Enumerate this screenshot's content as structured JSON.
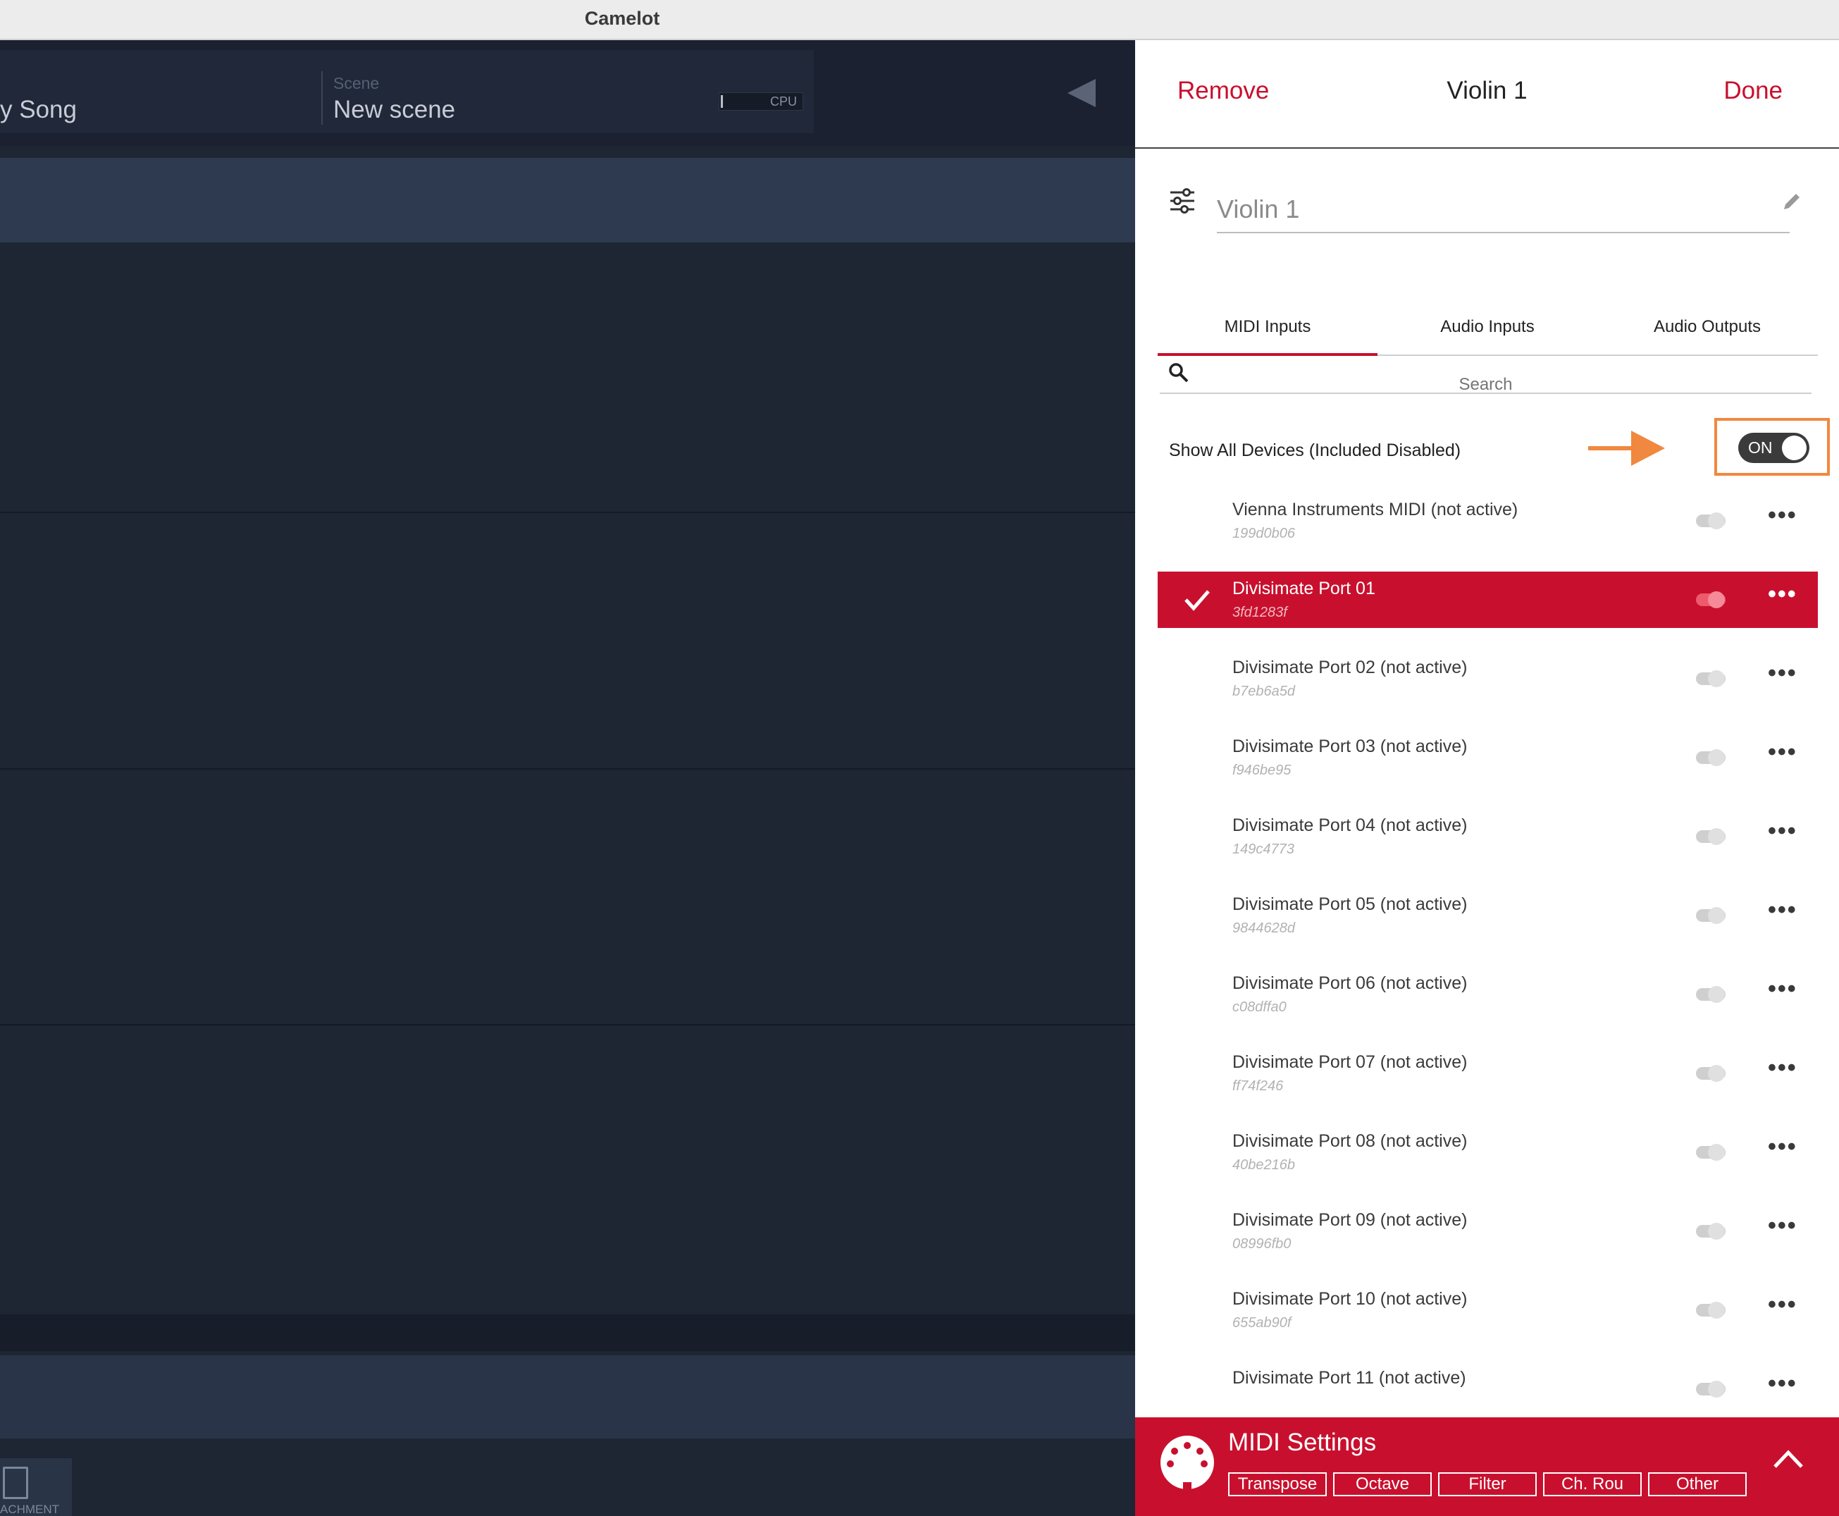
{
  "window": {
    "title": "Camelot"
  },
  "app": {
    "song_label": "y Song",
    "scene_caption": "Scene",
    "scene_name": "New scene",
    "cpu_label": "CPU",
    "attachment_label": "ACHMENT"
  },
  "panel": {
    "remove_label": "Remove",
    "title": "Violin 1",
    "done_label": "Done",
    "name_value": "Violin 1",
    "tabs": [
      {
        "label": "MIDI Inputs",
        "active": true
      },
      {
        "label": "Audio Inputs",
        "active": false
      },
      {
        "label": "Audio Outputs",
        "active": false
      }
    ],
    "search_placeholder": "Search",
    "show_all_label": "Show All Devices (Included Disabled)",
    "show_all_toggle": "ON",
    "devices": [
      {
        "name": "Vienna Instruments MIDI (not active)",
        "id": "199d0b06",
        "selected": false
      },
      {
        "name": "Divisimate Port 01",
        "id": "3fd1283f",
        "selected": true
      },
      {
        "name": "Divisimate Port 02 (not active)",
        "id": "b7eb6a5d",
        "selected": false
      },
      {
        "name": "Divisimate Port 03 (not active)",
        "id": "f946be95",
        "selected": false
      },
      {
        "name": "Divisimate Port 04 (not active)",
        "id": "149c4773",
        "selected": false
      },
      {
        "name": "Divisimate Port 05 (not active)",
        "id": "9844628d",
        "selected": false
      },
      {
        "name": "Divisimate Port 06 (not active)",
        "id": "c08dffa0",
        "selected": false
      },
      {
        "name": "Divisimate Port 07 (not active)",
        "id": "ff74f246",
        "selected": false
      },
      {
        "name": "Divisimate Port 08 (not active)",
        "id": "40be216b",
        "selected": false
      },
      {
        "name": "Divisimate Port 09 (not active)",
        "id": "08996fb0",
        "selected": false
      },
      {
        "name": "Divisimate Port 10 (not active)",
        "id": "655ab90f",
        "selected": false
      },
      {
        "name": "Divisimate Port 11 (not active)",
        "id": "",
        "selected": false
      }
    ],
    "midi_settings": {
      "title": "MIDI Settings",
      "buttons": [
        "Transpose",
        "Octave",
        "Filter",
        "Ch. Rou",
        "Other"
      ]
    }
  },
  "colors": {
    "accent": "#c8102e",
    "highlight": "#f0883f",
    "dark_bg": "#1e2533",
    "panel_bg": "#ffffff"
  },
  "icons": [
    "sliders-icon",
    "pencil-icon",
    "search-icon",
    "checkmark-icon",
    "toggle-icon",
    "more-icon",
    "midi-connector-icon",
    "chevron-up-icon",
    "back-triangle-icon",
    "document-icon"
  ]
}
